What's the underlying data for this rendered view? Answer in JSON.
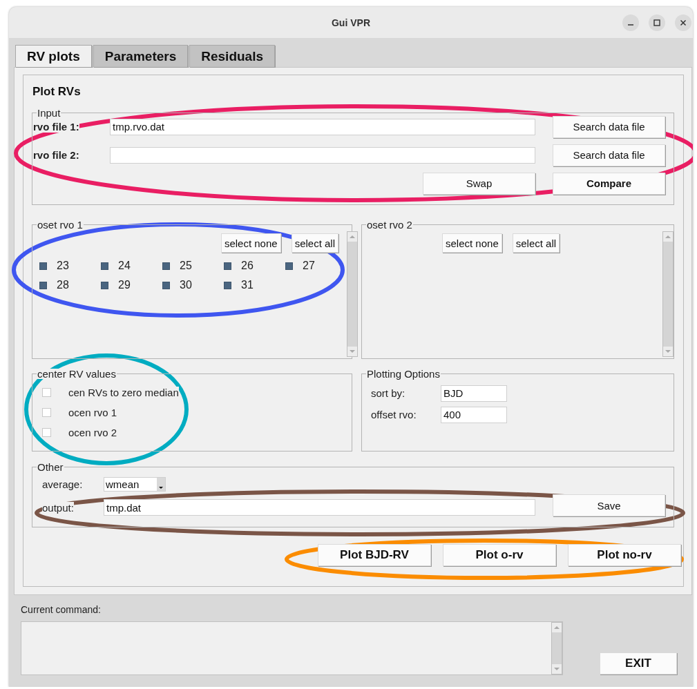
{
  "window": {
    "title": "Gui VPR"
  },
  "tabs": [
    {
      "label": "RV plots",
      "selected": true
    },
    {
      "label": "Parameters",
      "selected": false
    },
    {
      "label": "Residuals",
      "selected": false
    }
  ],
  "panel": {
    "title": "Plot RVs"
  },
  "input": {
    "title": "Input",
    "rows": [
      {
        "label": "rvo file 1:",
        "value": "tmp.rvo.dat",
        "button": "Search data file"
      },
      {
        "label": "rvo file 2:",
        "button": "Search data file"
      }
    ],
    "buttons": [
      {
        "label": "Swap",
        "bold": false
      },
      {
        "label": "Compare",
        "bold": true
      }
    ]
  },
  "subsets": [
    {
      "title": "oset rvo 1",
      "buttons": [
        "select none",
        "select all"
      ],
      "items": [
        {
          "label": "23",
          "checked": true
        },
        {
          "label": "24",
          "checked": true
        },
        {
          "label": "25",
          "checked": true
        },
        {
          "label": "26",
          "checked": true
        },
        {
          "label": "27",
          "checked": true
        },
        {
          "label": "28",
          "checked": true
        },
        {
          "label": "29",
          "checked": true
        },
        {
          "label": "30",
          "checked": true
        },
        {
          "label": "31",
          "checked": true
        }
      ]
    },
    {
      "title": "oset rvo 2",
      "buttons": [
        "select none",
        "select all"
      ]
    }
  ],
  "center": {
    "title": "center RV values",
    "options": [
      {
        "label": "cen RVs to zero median",
        "checked": false
      },
      {
        "label": "ocen rvo 1",
        "checked": false
      },
      {
        "label": "ocen rvo 2",
        "checked": false
      }
    ]
  },
  "plotting_options": {
    "title": "Plotting Options",
    "fields": [
      {
        "label": "sort by:",
        "value": "BJD"
      },
      {
        "label": "offset rvo:",
        "value": "400"
      }
    ]
  },
  "other": {
    "title": "Other",
    "average": {
      "label": "average:",
      "value": "wmean"
    },
    "output": {
      "label": "output:",
      "value": "tmp.dat",
      "button": "Save"
    }
  },
  "plot_buttons": [
    {
      "label": "Plot BJD-RV",
      "bold": true
    },
    {
      "label": "Plot o-rv",
      "bold": true
    },
    {
      "label": "Plot no-rv",
      "bold": true
    }
  ],
  "command": {
    "label": "Current command:"
  },
  "exit_button": {
    "label": "EXIT",
    "bold": true
  },
  "annotations": [
    {
      "color": "#e91e63"
    },
    {
      "color": "#3f56f0"
    },
    {
      "color": "#00acc1"
    },
    {
      "color": "#7a5547"
    },
    {
      "color": "#fb8c00"
    }
  ]
}
